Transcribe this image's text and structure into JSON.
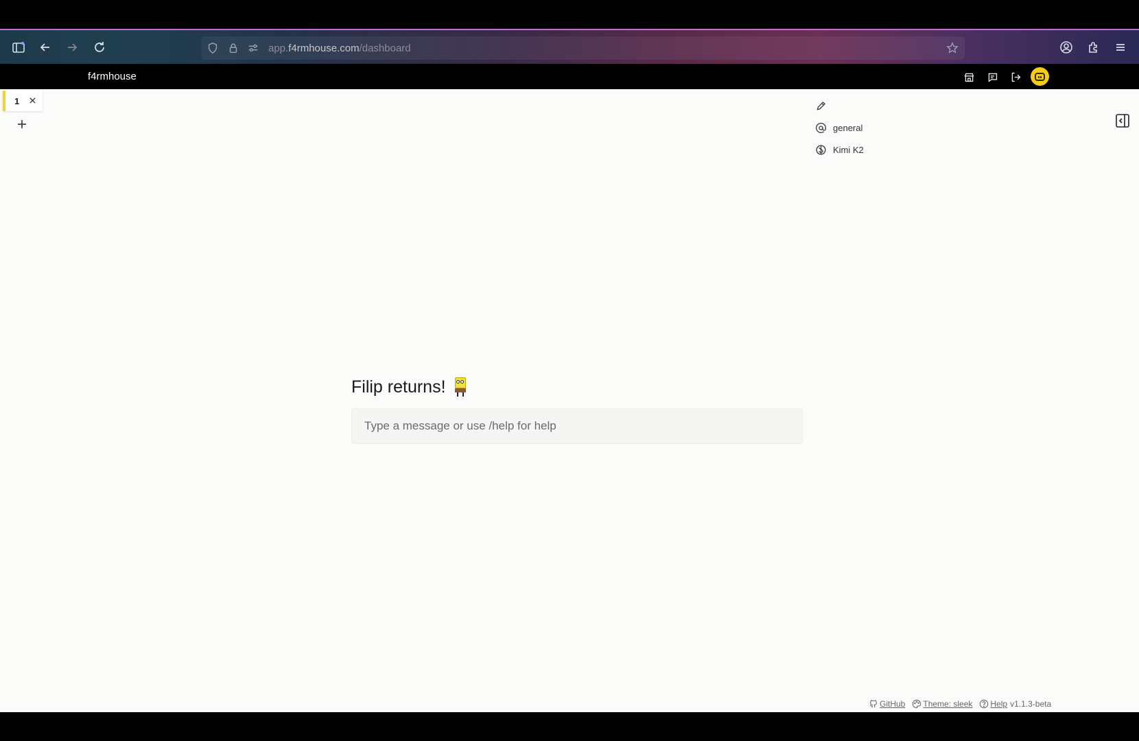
{
  "browser": {
    "url_prefix": "app.",
    "url_host": "f4rmhouse.com",
    "url_path": "/dashboard"
  },
  "header": {
    "brand": "f4rmhouse"
  },
  "tabs": [
    {
      "label": "1"
    }
  ],
  "sidebar": {
    "items": [
      {
        "label": "general",
        "icon": "at-icon"
      },
      {
        "label": "Kimi K2",
        "icon": "model-icon"
      }
    ]
  },
  "welcome": {
    "title": "Filip returns!"
  },
  "composer": {
    "placeholder": "Type a message or use /help for help",
    "value": ""
  },
  "footer": {
    "github": "GitHub",
    "theme": "Theme: sleek",
    "help": "Help",
    "version": "v1.1.3-beta"
  },
  "colors": {
    "accent_tab": "#f4d03f",
    "avatar": "#f3cc1a",
    "background": "#fbfbfa"
  }
}
